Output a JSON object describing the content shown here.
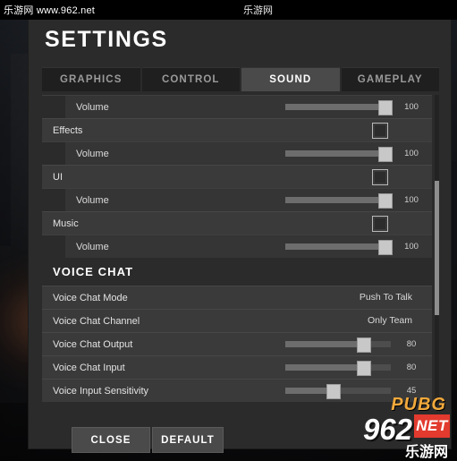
{
  "watermark": {
    "top_left": "乐游网 www.962.net",
    "top_center": "乐游网",
    "logo_title": "PUBG",
    "logo_962": "962",
    "logo_net": "NET",
    "logo_cn": "乐游网"
  },
  "panel": {
    "title": "SETTINGS",
    "tabs": [
      {
        "label": "GRAPHICS",
        "active": false
      },
      {
        "label": "CONTROL",
        "active": false
      },
      {
        "label": "SOUND",
        "active": true
      },
      {
        "label": "GAMEPLAY",
        "active": false
      }
    ],
    "rows": [
      {
        "type": "slider-sub",
        "label": "Volume",
        "value": "100",
        "percent": 100
      },
      {
        "type": "checkbox-wide",
        "label": "Effects",
        "checked": false
      },
      {
        "type": "slider-sub",
        "label": "Volume",
        "value": "100",
        "percent": 100
      },
      {
        "type": "checkbox-wide",
        "label": "UI",
        "checked": false
      },
      {
        "type": "slider-sub",
        "label": "Volume",
        "value": "100",
        "percent": 100
      },
      {
        "type": "checkbox-wide",
        "label": "Music",
        "checked": false
      },
      {
        "type": "slider-sub",
        "label": "Volume",
        "value": "100",
        "percent": 100
      },
      {
        "type": "section",
        "label": "VOICE CHAT"
      },
      {
        "type": "option-wide",
        "label": "Voice Chat Mode",
        "value": "Push To Talk"
      },
      {
        "type": "option-wide",
        "label": "Voice Chat Channel",
        "value": "Only Team"
      },
      {
        "type": "slider-wide",
        "label": "Voice Chat Output",
        "value": "80",
        "percent": 80
      },
      {
        "type": "slider-wide",
        "label": "Voice Chat Input",
        "value": "80",
        "percent": 80
      },
      {
        "type": "slider-wide",
        "label": "Voice Input Sensitivity",
        "value": "45",
        "percent": 45
      }
    ],
    "buttons": {
      "close": "CLOSE",
      "default": "DEFAULT"
    }
  }
}
